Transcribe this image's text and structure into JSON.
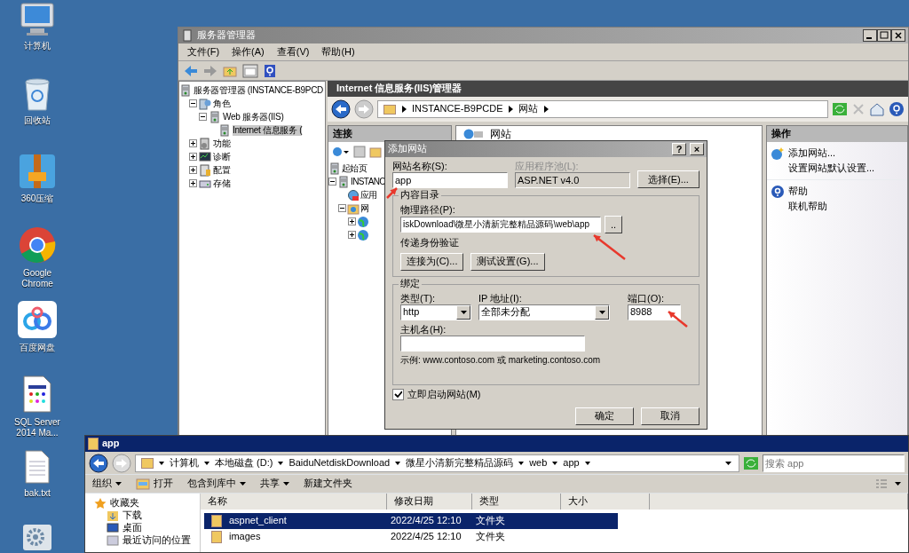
{
  "desktop_icons": [
    {
      "label": "计算机",
      "kind": "computer"
    },
    {
      "label": "回收站",
      "kind": "recycle-bin"
    },
    {
      "label": "360压缩",
      "kind": "archive"
    },
    {
      "label": "Google Chrome",
      "kind": "browser"
    },
    {
      "label": "百度网盘",
      "kind": "cloud"
    },
    {
      "label": "SQL Server 2014 Ma...",
      "kind": "app-doc"
    },
    {
      "label": "bak.txt",
      "kind": "text-file"
    },
    {
      "kind": "gear"
    }
  ],
  "server_manager": {
    "title": "服务器管理器",
    "menu": [
      "文件(F)",
      "操作(A)",
      "查看(V)",
      "帮助(H)"
    ],
    "tree": [
      {
        "label": "服务器管理器 (INSTANCE-B9PCD",
        "kind": "server",
        "selected": false,
        "children": [
          {
            "label": "角色",
            "kind": "roles",
            "expanded": true,
            "selected": false,
            "children": [
              {
                "label": "Web 服务器(IIS)",
                "kind": "server",
                "expanded": true,
                "selected": false,
                "children": [
                  {
                    "label": "Internet 信息服务 (",
                    "kind": "server",
                    "selected": true
                  }
                ]
              }
            ]
          },
          {
            "label": "功能",
            "kind": "features",
            "expanded": false,
            "selected": false
          },
          {
            "label": "诊断",
            "kind": "diagnostics",
            "expanded": false,
            "selected": false
          },
          {
            "label": "配置",
            "kind": "config",
            "expanded": false,
            "selected": false
          },
          {
            "label": "存储",
            "kind": "storage",
            "expanded": false,
            "selected": false
          }
        ]
      }
    ]
  },
  "iis": {
    "title": "Internet 信息服务(IIS)管理器",
    "breadcrumb": [
      "INSTANCE-B9PCDE",
      "网站"
    ],
    "connections_title": "连接",
    "connections_tree": [
      {
        "label": "起始页",
        "kind": "server"
      },
      {
        "label": "INSTANC",
        "kind": "server",
        "expanded": true,
        "children": [
          {
            "label": "应用",
            "kind": "pool"
          },
          {
            "label": "网",
            "kind": "sites",
            "expanded": true,
            "children": [
              {
                "kind": "globe",
                "expanded": false
              },
              {
                "kind": "globe",
                "expanded": false
              }
            ]
          }
        ]
      }
    ],
    "center_title": "网站",
    "actions_title": "操作",
    "action_groups": [
      [
        {
          "label": "添加网站...",
          "kind": "add-globe"
        },
        {
          "label": "设置网站默认设置..."
        }
      ],
      [
        {
          "label": "帮助",
          "kind": "help"
        },
        {
          "label": "联机帮助"
        }
      ]
    ]
  },
  "dialog": {
    "title": "添加网站",
    "title_buttons": [
      "?",
      "×"
    ],
    "site_name": {
      "label": "网站名称(S):",
      "value": "app"
    },
    "app_pool": {
      "label": "应用程序池(L):",
      "value": "ASP.NET v4.0",
      "disabled": true
    },
    "select_button": "选择(E)...",
    "content_group": "内容目录",
    "physical_path": {
      "label": "物理路径(P):",
      "value": "iskDownload\\微星小清新完整精品源码\\web\\app"
    },
    "browse_button": "..",
    "pass_auth": "传递身份验证",
    "auth_buttons": [
      "连接为(C)...",
      "测试设置(G)..."
    ],
    "binding_group": "绑定",
    "type": {
      "label": "类型(T):",
      "value": "http"
    },
    "ip": {
      "label": "IP 地址(I):",
      "value": "全部未分配"
    },
    "port": {
      "label": "端口(O):",
      "value": "8988"
    },
    "host": {
      "label": "主机名(H):"
    },
    "example": "示例: www.contoso.com 或 marketing.contoso.com",
    "start_now": {
      "label": "立即启动网站(M)",
      "checked": true
    },
    "ok": "确定",
    "cancel": "取消"
  },
  "annotation_arrows": [
    {
      "kind": "arrow"
    },
    {
      "kind": "arrow"
    },
    {
      "kind": "arrow"
    }
  ],
  "explorer": {
    "title": "app",
    "address": [
      "计算机",
      "本地磁盘 (D:)",
      "BaiduNetdiskDownload",
      "微星小清新完整精品源码",
      "web",
      "app"
    ],
    "search": {
      "placeholder": "搜索 app"
    },
    "toolbar": [
      {
        "label": "组织",
        "dropdown": true
      },
      {
        "label": "打开",
        "kind": "open"
      },
      {
        "label": "包含到库中",
        "dropdown": true
      },
      {
        "label": "共享",
        "dropdown": true
      },
      {
        "label": "新建文件夹",
        "dropdown": false
      }
    ],
    "nav": [
      {
        "label": "收藏夹",
        "kind": "star"
      },
      {
        "label": "下载",
        "kind": "download"
      },
      {
        "label": "桌面",
        "kind": "desktop"
      },
      {
        "label": "最近访问的位置",
        "kind": "recent"
      }
    ],
    "columns": [
      "名称",
      "修改日期",
      "类型",
      "大小"
    ],
    "rows": [
      {
        "name": "aspnet_client",
        "date": "2022/4/25 12:10",
        "type": "文件夹",
        "selected": true
      },
      {
        "name": "images",
        "date": "2022/4/25 12:10",
        "type": "文件夹",
        "selected": false
      }
    ]
  }
}
